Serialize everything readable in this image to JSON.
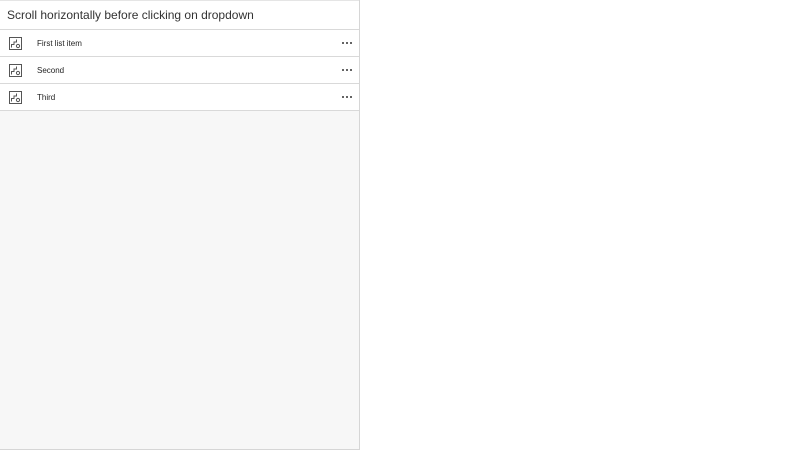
{
  "panel": {
    "title": "Scroll horizontally before clicking on dropdown"
  },
  "list": {
    "items": [
      {
        "label": "First list item",
        "icon": "image-icon",
        "menu_icon": "more-horizontal-icon"
      },
      {
        "label": "Second",
        "icon": "image-icon",
        "menu_icon": "more-horizontal-icon"
      },
      {
        "label": "Third",
        "icon": "image-icon",
        "menu_icon": "more-horizontal-icon"
      }
    ]
  },
  "colors": {
    "panel_background": "#f7f7f7",
    "item_background": "#ffffff",
    "border": "#d9d9d9",
    "text": "#333333"
  }
}
